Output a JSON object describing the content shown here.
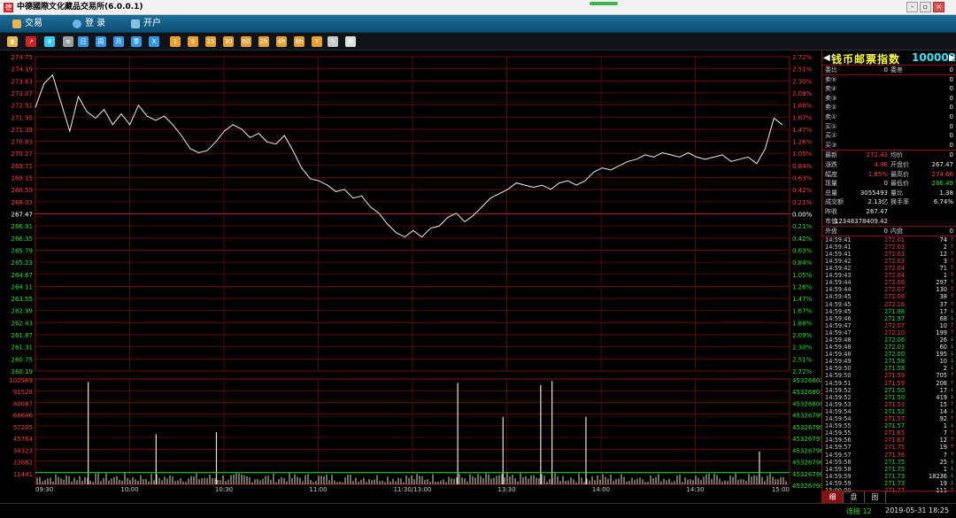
{
  "window": {
    "title": "中德國際文化藏品交易所(6.0.0.1)",
    "logo": "德"
  },
  "menu": [
    {
      "label": "交易",
      "icon": "trade-icon",
      "color": "#e8b84a"
    },
    {
      "label": "登 录",
      "icon": "login-icon",
      "color": "#6fb3e8"
    },
    {
      "label": "开户",
      "icon": "open-account-icon",
      "color": "#8fbfe0"
    }
  ],
  "toolbar": {
    "icons": [
      {
        "name": "time-share-icon",
        "color": "#e8b84a",
        "glyph": "▮"
      },
      {
        "name": "kline-icon",
        "color": "#d42020",
        "glyph": "↗"
      },
      {
        "name": "multi-chart-icon",
        "color": "#33ccff",
        "glyph": "⋔"
      },
      {
        "name": "quote-list-icon",
        "color": "#9aa0a8",
        "glyph": "≡"
      },
      {
        "name": "day-icon",
        "color": "#3399e6",
        "glyph": "日"
      },
      {
        "name": "week-icon",
        "color": "#3399e6",
        "glyph": "周"
      },
      {
        "name": "month-icon",
        "color": "#3399e6",
        "glyph": "月"
      },
      {
        "name": "season-icon",
        "color": "#3399e6",
        "glyph": "季"
      },
      {
        "name": "year-icon",
        "color": "#3399e6",
        "glyph": "X"
      },
      {
        "name": "min1-icon",
        "color": "#e8a030",
        "glyph": "1"
      },
      {
        "name": "min5-icon",
        "color": "#e8a030",
        "glyph": "5"
      },
      {
        "name": "min15-icon",
        "color": "#e8a030",
        "glyph": "15"
      },
      {
        "name": "min30-icon",
        "color": "#e8a030",
        "glyph": "30"
      },
      {
        "name": "min60-icon",
        "color": "#e8a030",
        "glyph": "60"
      },
      {
        "name": "hour2-icon",
        "color": "#e8a030",
        "glyph": "2h"
      },
      {
        "name": "hour4-icon",
        "color": "#e8a030",
        "glyph": "4h"
      },
      {
        "name": "hour8-icon",
        "color": "#e8a030",
        "glyph": "8h"
      },
      {
        "name": "indicator-icon",
        "color": "#e8a030",
        "glyph": "Y"
      },
      {
        "name": "draw-tool-icon",
        "color": "#c8c8c8",
        "glyph": "✎"
      },
      {
        "name": "settings-gear-icon",
        "color": "#dddddd",
        "glyph": "⚙"
      }
    ]
  },
  "chart_data": {
    "type": "line",
    "price_axis_left": [
      "274.75",
      "274.19",
      "273.63",
      "273.07",
      "272.51",
      "271.95",
      "271.39",
      "270.83",
      "270.27",
      "269.71",
      "269.15",
      "268.59",
      "268.03",
      "267.47",
      "266.91",
      "266.35",
      "265.79",
      "265.23",
      "264.67",
      "264.11",
      "263.55",
      "262.99",
      "262.43",
      "261.87",
      "261.31",
      "260.75",
      "260.19"
    ],
    "pct_axis_right": [
      "2.72%",
      "2.51%",
      "2.30%",
      "2.09%",
      "1.88%",
      "1.67%",
      "1.47%",
      "1.26%",
      "1.05%",
      "0.84%",
      "0.63%",
      "0.42%",
      "0.21%",
      "0.00%",
      "0.21%",
      "0.42%",
      "0.63%",
      "0.84%",
      "1.05%",
      "1.26%",
      "1.47%",
      "1.67%",
      "1.88%",
      "2.09%",
      "2.30%",
      "2.51%",
      "2.72%"
    ],
    "ylim": [
      260.19,
      274.75
    ],
    "prev_close": 267.47,
    "price_series": [
      272.4,
      273.5,
      273.9,
      272.6,
      271.3,
      272.9,
      272.2,
      271.9,
      272.3,
      271.6,
      272.1,
      271.6,
      272.5,
      272.0,
      271.8,
      272.0,
      271.6,
      271.1,
      270.5,
      270.3,
      270.4,
      270.8,
      271.3,
      271.6,
      271.4,
      271.0,
      271.2,
      270.8,
      270.7,
      271.1,
      270.4,
      269.6,
      269.1,
      269.0,
      268.8,
      268.5,
      268.6,
      268.2,
      268.3,
      267.8,
      267.5,
      267.0,
      266.6,
      266.4,
      266.7,
      266.4,
      266.8,
      266.9,
      267.3,
      267.5,
      267.1,
      267.4,
      267.8,
      268.2,
      268.4,
      268.6,
      268.9,
      268.8,
      268.7,
      268.8,
      268.6,
      268.9,
      269.0,
      268.8,
      269.0,
      269.4,
      269.6,
      269.5,
      269.7,
      269.9,
      270.0,
      270.2,
      270.1,
      270.3,
      270.2,
      270.1,
      270.3,
      270.1,
      270.0,
      270.1,
      270.2,
      269.9,
      270.0,
      270.1,
      269.8,
      270.5,
      271.9,
      271.6
    ],
    "volume_axis_left": [
      "102969",
      "91528",
      "80087",
      "68646",
      "57205",
      "45764",
      "34323",
      "22882",
      "11441"
    ],
    "volume_axis_right": [
      "45326802",
      "45326801",
      "45326800",
      "45326799",
      "45326799",
      "45326797",
      "45326796",
      "45326796",
      "45326796",
      "45326793"
    ],
    "time_labels": [
      "09:30",
      "10:00",
      "10:30",
      "11:00",
      "11:30/13:00",
      "13:30",
      "14:00",
      "14:30",
      "15:00"
    ],
    "volume_spikes": [
      {
        "t": 0.07,
        "v": 100000
      },
      {
        "t": 0.16,
        "v": 49000
      },
      {
        "t": 0.24,
        "v": 51000
      },
      {
        "t": 0.56,
        "v": 99000
      },
      {
        "t": 0.62,
        "v": 66000
      },
      {
        "t": 0.67,
        "v": 97000
      },
      {
        "t": 0.685,
        "v": 101000
      },
      {
        "t": 0.73,
        "v": 66000
      },
      {
        "t": 0.96,
        "v": 32000
      }
    ],
    "grid": true
  },
  "quote": {
    "name": "钱币邮票指数",
    "code": "100002",
    "weibi": {
      "label": "委比",
      "value": "0",
      "label2": "委差",
      "value2": "0"
    },
    "sells": [
      {
        "label": "卖⑤",
        "value": "0"
      },
      {
        "label": "卖④",
        "value": "0"
      },
      {
        "label": "卖③",
        "value": "0"
      },
      {
        "label": "卖②",
        "value": "0"
      },
      {
        "label": "卖①",
        "value": "0"
      }
    ],
    "buys": [
      {
        "label": "买①",
        "value": "0"
      },
      {
        "label": "买②",
        "value": "0"
      },
      {
        "label": "买③",
        "value": "0"
      }
    ],
    "stats": [
      {
        "l1": "最新",
        "v1": "272.43",
        "c1": "red",
        "l2": "均价",
        "v2": "0",
        "c2": "white"
      },
      {
        "l1": "涨跌",
        "v1": "4.96",
        "c1": "red",
        "l2": "开盘价",
        "v2": "267.47",
        "c2": "white"
      },
      {
        "l1": "幅度",
        "v1": "1.85%",
        "c1": "red",
        "l2": "最高价",
        "v2": "274.66",
        "c2": "red"
      },
      {
        "l1": "现量",
        "v1": "0",
        "c1": "white",
        "l2": "最低价",
        "v2": "266.49",
        "c2": "green"
      },
      {
        "l1": "总量",
        "v1": "3055493",
        "c1": "white",
        "l2": "量比",
        "v2": "1.38",
        "c2": "white"
      },
      {
        "l1": "成交额",
        "v1": "2.13亿",
        "c1": "white",
        "l2": "换手率",
        "v2": "6.74%",
        "c2": "white"
      },
      {
        "l1": "昨收",
        "v1": "267.47",
        "c1": "white",
        "l2": "",
        "v2": "",
        "c2": "white"
      },
      {
        "l1": "市值",
        "v1": "12348378409.42",
        "c1": "white",
        "l2": "",
        "v2": "",
        "c2": "white"
      }
    ],
    "outer": {
      "label": "外盘",
      "value": "0",
      "label2": "内盘",
      "value2": "0"
    }
  },
  "ticks": [
    {
      "t": "14:59:41",
      "p": "272.01",
      "q": "74",
      "d": "up"
    },
    {
      "t": "14:59:41",
      "p": "272.03",
      "q": "2",
      "d": "up"
    },
    {
      "t": "14:59:41",
      "p": "272.03",
      "q": "12",
      "d": "up"
    },
    {
      "t": "14:59:42",
      "p": "272.03",
      "q": "3",
      "d": "up"
    },
    {
      "t": "14:59:42",
      "p": "272.04",
      "q": "71",
      "d": "up"
    },
    {
      "t": "14:59:43",
      "p": "272.04",
      "q": "1",
      "d": "up"
    },
    {
      "t": "14:59:44",
      "p": "272.06",
      "q": "297",
      "d": "up"
    },
    {
      "t": "14:59:44",
      "p": "272.07",
      "q": "130",
      "d": "up"
    },
    {
      "t": "14:59:45",
      "p": "272.08",
      "q": "38",
      "d": "up"
    },
    {
      "t": "14:59:45",
      "p": "272.16",
      "q": "37",
      "d": "up"
    },
    {
      "t": "14:59:45",
      "p": "271.98",
      "q": "17",
      "d": "down"
    },
    {
      "t": "14:59:46",
      "p": "271.97",
      "q": "68",
      "d": "down"
    },
    {
      "t": "14:59:47",
      "p": "272.07",
      "q": "10",
      "d": "up"
    },
    {
      "t": "14:59:47",
      "p": "272.10",
      "q": "199",
      "d": "up"
    },
    {
      "t": "14:59:48",
      "p": "272.06",
      "q": "26",
      "d": "down"
    },
    {
      "t": "14:59:48",
      "p": "272.03",
      "q": "60",
      "d": "down"
    },
    {
      "t": "14:59:48",
      "p": "272.00",
      "q": "195",
      "d": "down"
    },
    {
      "t": "14:59:49",
      "p": "271.58",
      "q": "10",
      "d": "down"
    },
    {
      "t": "14:59:50",
      "p": "271.58",
      "q": "2",
      "d": "down"
    },
    {
      "t": "14:59:50",
      "p": "271.59",
      "q": "705",
      "d": "up"
    },
    {
      "t": "14:59:51",
      "p": "271.59",
      "q": "208",
      "d": "up"
    },
    {
      "t": "14:59:52",
      "p": "271.50",
      "q": "17",
      "d": "down"
    },
    {
      "t": "14:59:52",
      "p": "271.50",
      "q": "419",
      "d": "down"
    },
    {
      "t": "14:59:53",
      "p": "271.53",
      "q": "15",
      "d": "up"
    },
    {
      "t": "14:59:54",
      "p": "271.52",
      "q": "14",
      "d": "down"
    },
    {
      "t": "14:59:54",
      "p": "271.57",
      "q": "92",
      "d": "up"
    },
    {
      "t": "14:59:55",
      "p": "271.57",
      "q": "1",
      "d": "down"
    },
    {
      "t": "14:59:55",
      "p": "271.65",
      "q": "7",
      "d": "up"
    },
    {
      "t": "14:59:56",
      "p": "271.67",
      "q": "12",
      "d": "up"
    },
    {
      "t": "14:59:57",
      "p": "271.75",
      "q": "19",
      "d": "up"
    },
    {
      "t": "14:59:57",
      "p": "271.76",
      "q": "7",
      "d": "up"
    },
    {
      "t": "14:59:58",
      "p": "271.75",
      "q": "25",
      "d": "down"
    },
    {
      "t": "14:59:58",
      "p": "271.75",
      "q": "1",
      "d": "down"
    },
    {
      "t": "14:59:59",
      "p": "271.73",
      "q": "18236",
      "d": "down"
    },
    {
      "t": "14:59:59",
      "p": "271.73",
      "q": "19",
      "d": "down"
    },
    {
      "t": "15:00:00",
      "p": "271.77",
      "q": "111",
      "d": "up"
    }
  ],
  "panel_tabs": [
    "细",
    "盘",
    "图"
  ],
  "status": {
    "connection": "连接 12",
    "datetime": "2019-05-31 18:25"
  }
}
